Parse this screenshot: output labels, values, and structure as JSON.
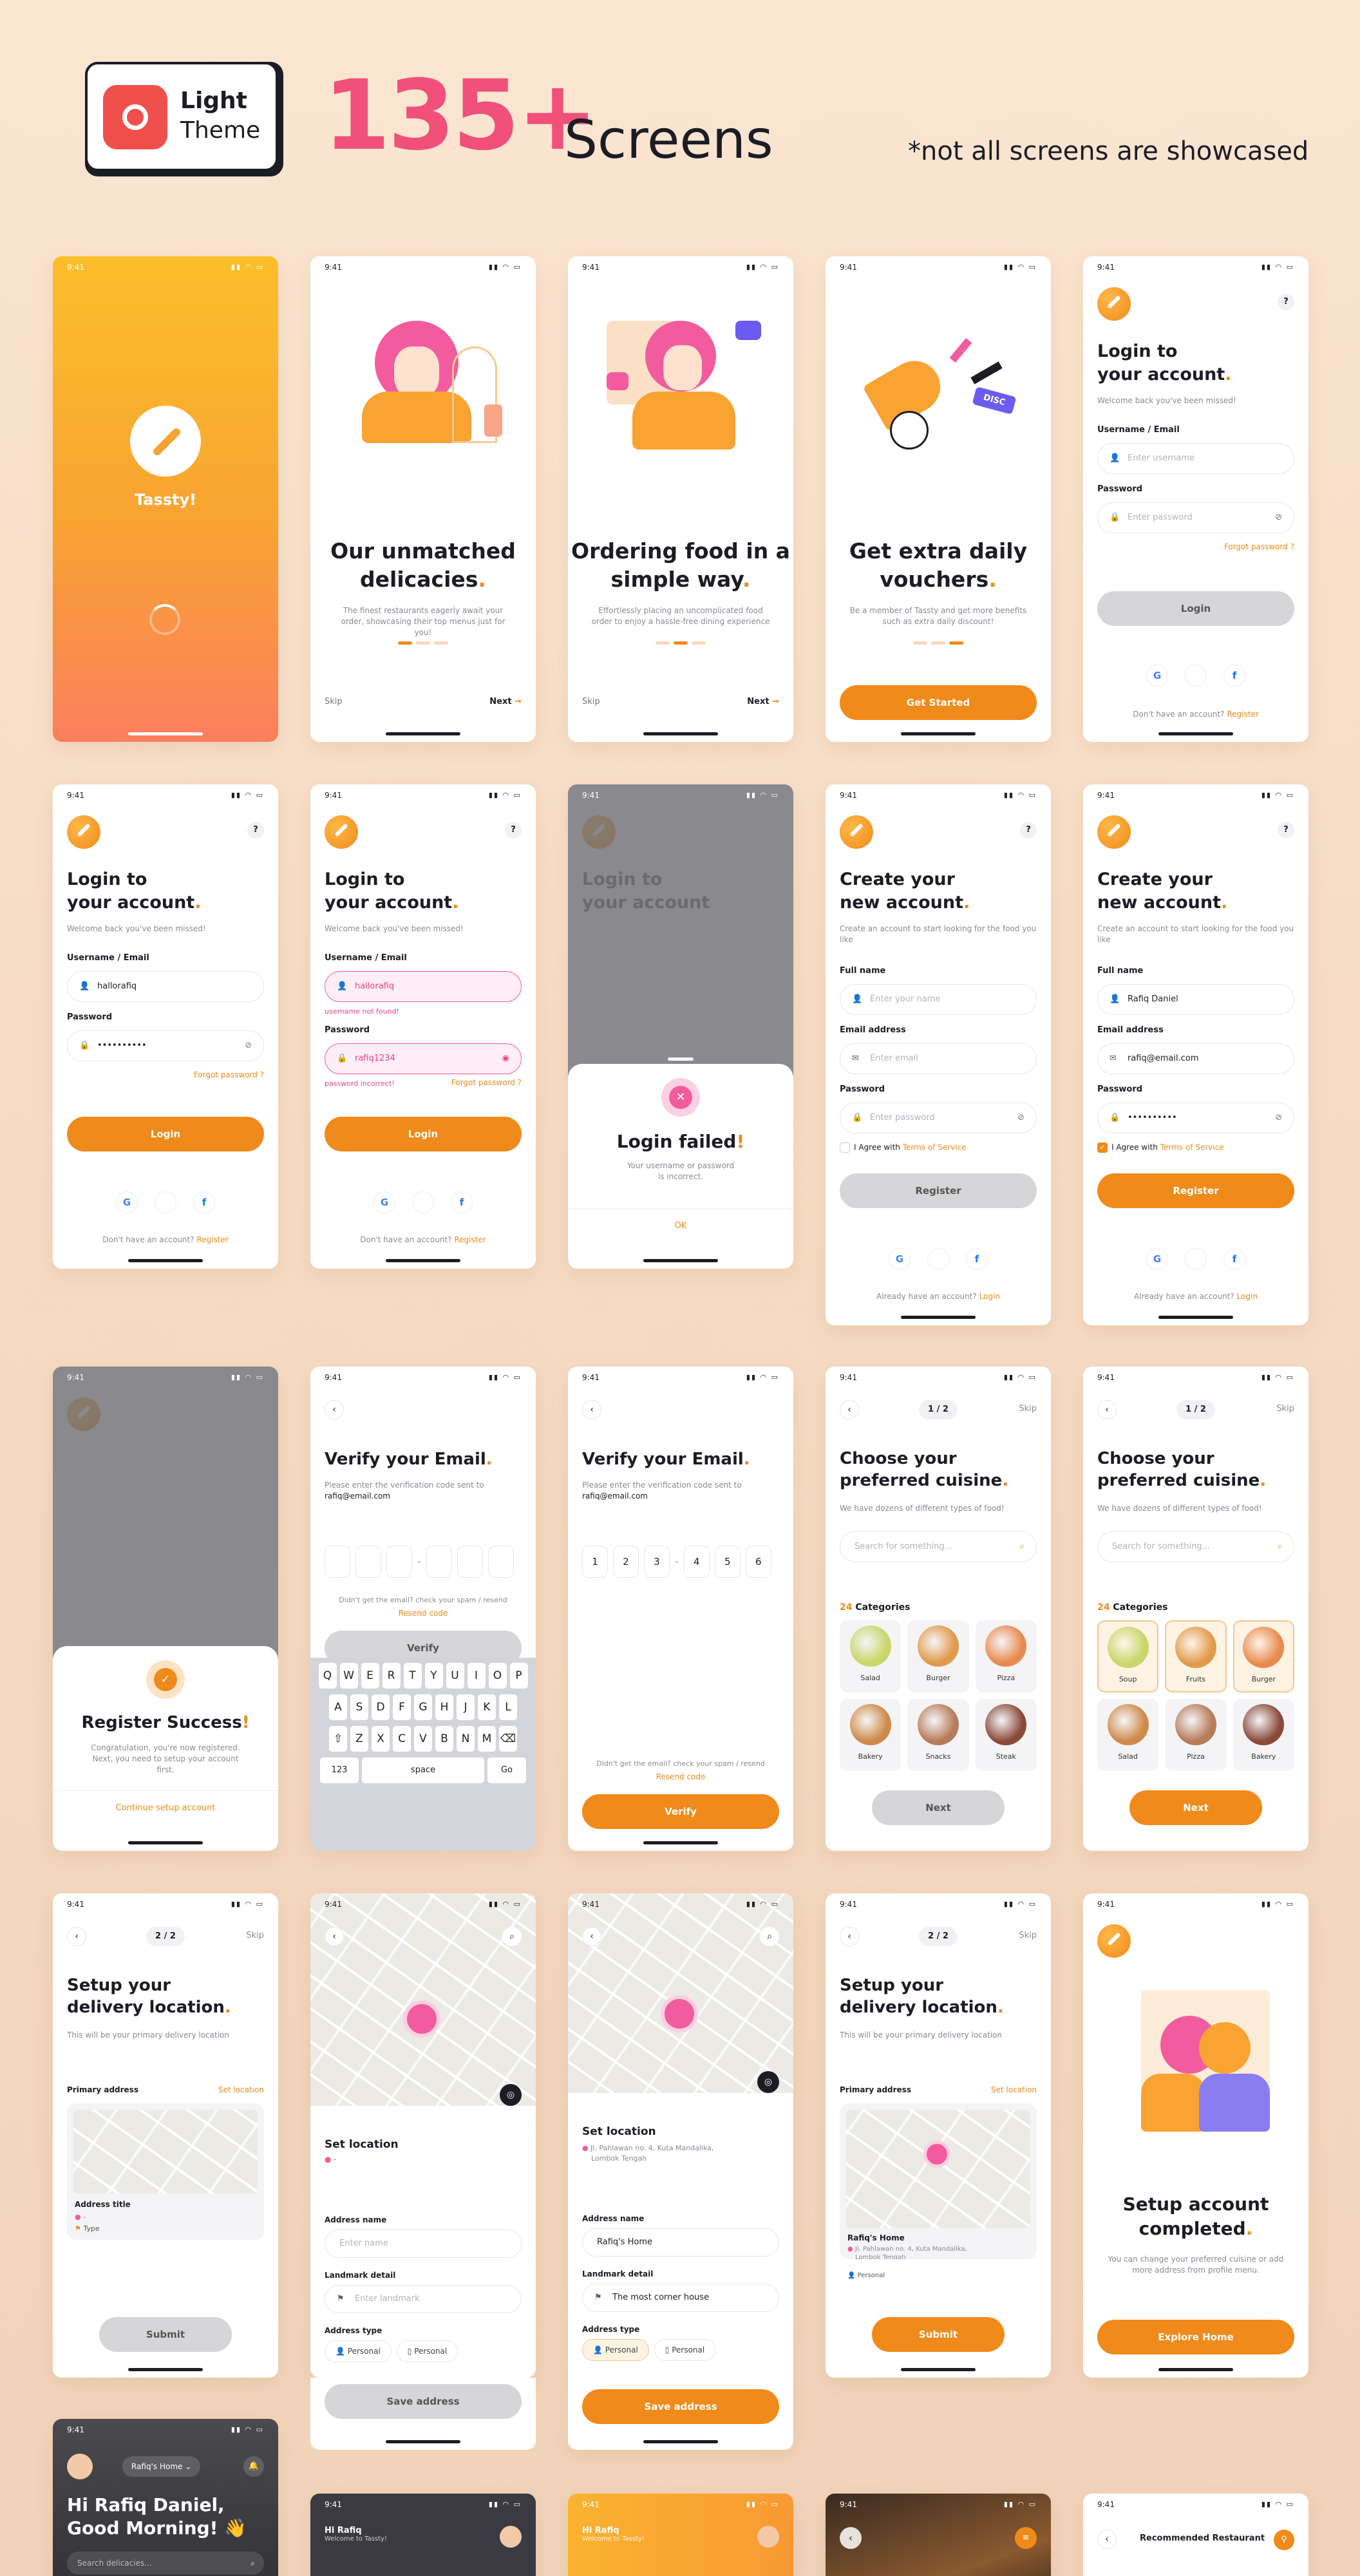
{
  "header": {
    "badge_line1": "Light",
    "badge_line2": "Theme",
    "count": "135+",
    "screens": "Screens",
    "note": "*not all screens are showcased"
  },
  "status": {
    "time": "9:41",
    "icons": "▮▮ ◠ ▭"
  },
  "splash": {
    "app_name": "Tassty!"
  },
  "onboarding": [
    {
      "title_1": "Our unmatched",
      "title_2": "delicacies",
      "desc": "The finest restaurants eagerly await your order, showcasing their top menus just for you!",
      "skip": "Skip",
      "next": "Next"
    },
    {
      "title_1": "Ordering food in a",
      "title_2": "simple way",
      "desc": "Effortlessly placing an uncomplicated food order to enjoy a hassle-free dining experience",
      "skip": "Skip",
      "next": "Next"
    },
    {
      "title_1": "Get extra daily",
      "title_2": "vouchers",
      "desc": "Be a member of Tassty and get more benefits such as extra daily discount!",
      "cta": "Get Started",
      "disc": "DISC"
    }
  ],
  "login": {
    "title_1": "Login to",
    "title_2": "your account",
    "welcome": "Welcome back you've been missed!",
    "user_label": "Username / Email",
    "user_placeholder": "Enter username",
    "pass_label": "Password",
    "pass_placeholder": "Enter password",
    "forgot": "Forgot password ?",
    "button": "Login",
    "footer": "Don't have an account?",
    "footer_link": "Register",
    "filled_user": "hallorafiq",
    "filled_pass": "••••••••••",
    "error_user": "hallorafiq",
    "error_user_msg": "username not found!",
    "error_pass": "rafiq1234",
    "error_pass_msg": "password incorrect!",
    "help": "?"
  },
  "login_failed": {
    "title": "Login failed",
    "desc_1": "Your username or password",
    "desc_2": "is incorrect.",
    "ok": "OK"
  },
  "register": {
    "title_1": "Create your",
    "title_2": "new account",
    "desc": "Create an account to start looking for the food you like",
    "name_label": "Full name",
    "name_placeholder": "Enter your name",
    "name_value": "Rafiq Daniel",
    "email_label": "Email address",
    "email_placeholder": "Enter email",
    "email_value": "rafiq@email.com",
    "pass_label": "Password",
    "pass_placeholder": "Enter password",
    "pass_value": "••••••••••",
    "agree": "I Agree with",
    "terms": "Terms of Service",
    "button": "Register",
    "footer": "Already have an account?",
    "footer_link": "Login"
  },
  "register_success": {
    "title": "Register Success",
    "desc": "Congratulation, you're now registered. Next, you need to setup your account first.",
    "cta": "Continue setup account"
  },
  "verify": {
    "title": "Verify your Email",
    "desc_1": "Please enter the verification code sent to",
    "email": "rafiq@email.com",
    "resend_q": "Didn't get the email? check your spam / resend",
    "resend": "Resend code",
    "button": "Verify",
    "code": [
      "1",
      "2",
      "3",
      "4",
      "5",
      "6"
    ]
  },
  "keyboard": {
    "row1": [
      "Q",
      "W",
      "E",
      "R",
      "T",
      "Y",
      "U",
      "I",
      "O",
      "P"
    ],
    "row2": [
      "A",
      "S",
      "D",
      "F",
      "G",
      "H",
      "J",
      "K",
      "L"
    ],
    "row3": [
      "⇧",
      "Z",
      "X",
      "C",
      "V",
      "B",
      "N",
      "M",
      "⌫"
    ],
    "num": "123",
    "space": "space",
    "go": "Go"
  },
  "cuisine": {
    "pager": "1 / 2",
    "skip": "Skip",
    "title_1": "Choose your",
    "title_2": "preferred cuisine",
    "desc": "We have dozens of different types of food!",
    "search_placeholder": "Search for something...",
    "count": "24",
    "count_label": "Categories",
    "button": "Next",
    "cats_a": [
      "Salad",
      "Burger",
      "Pizza",
      "Bakery",
      "Snacks",
      "Steak"
    ],
    "cats_b": [
      "Soup",
      "Fruits",
      "Burger",
      "Salad",
      "Pizza",
      "Bakery"
    ]
  },
  "location": {
    "pager": "2 / 2",
    "skip": "Skip",
    "title_1": "Setup your",
    "title_2": "delivery location",
    "desc": "This will be your primary delivery location",
    "primary": "Primary address",
    "set": "Set location",
    "addr_title": "Address title",
    "addr_dash": "-",
    "type": "Type",
    "submit": "Submit",
    "set_location": "Set location",
    "addr_name": "Address name",
    "addr_name_placeholder": "Enter name",
    "landmark": "Landmark detail",
    "landmark_placeholder": "Enter landmark",
    "addr_type": "Address type",
    "personal": "Personal",
    "save": "Save address",
    "full_addr_1": "Jl. Pahlawan no. 4, Kuta Mandalika,",
    "full_addr_2": "Lombok Tengah",
    "home": "Rafiq's Home",
    "corner": "The most corner house"
  },
  "completed": {
    "title_1": "Setup account",
    "title_2": "completed",
    "desc": "You can change your preferred cuisine or add more address from profile menu.",
    "cta": "Explore Home"
  },
  "home": {
    "location": "Rafiq's Home",
    "greet_1": "Hi Rafiq Daniel,",
    "greet_2": "Good Morning! 👋",
    "search": "Search delicacies...",
    "hi": "Hi Rafiq",
    "welcome": "Welcome to Tassty!",
    "recommended": "Recommended Restaurant"
  }
}
